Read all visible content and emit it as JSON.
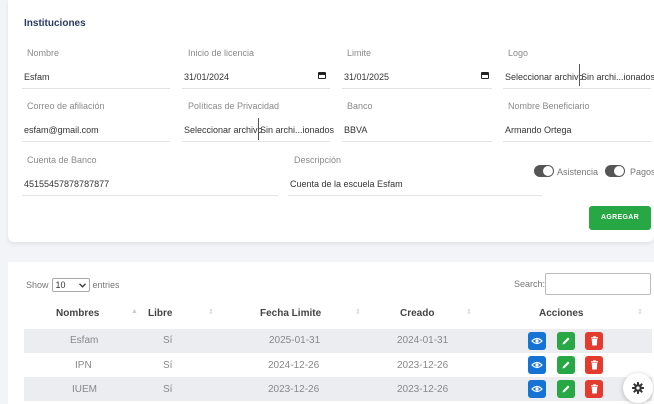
{
  "form": {
    "title": "Instituciones",
    "nombre": {
      "label": "Nombre",
      "value": "Esfam"
    },
    "inicio": {
      "label": "Inicio de licencia",
      "value": "31/01/2024"
    },
    "limite": {
      "label": "Limite",
      "value": "31/01/2025"
    },
    "logo": {
      "label": "Logo",
      "button": "Seleccionar archivo",
      "file": "Sin archi...ionados"
    },
    "correo": {
      "label": "Correo de afiliación",
      "value": "esfam@gmail.com"
    },
    "politicas": {
      "label": "Políticas de Privacidad",
      "button": "Seleccionar archivo",
      "file": "Sin archi...ionados"
    },
    "banco": {
      "label": "Banco",
      "value": "BBVA"
    },
    "beneficiario": {
      "label": "Nombre Beneficiario",
      "value": "Armando Ortega"
    },
    "cuenta": {
      "label": "Cuenta de Banco",
      "value": "45155457878787877"
    },
    "descripcion": {
      "label": "Descripción",
      "value": "Cuenta de la escuela Esfam"
    },
    "toggle_asistencia": "Asistencia",
    "toggle_pagos": "Pagos",
    "submit": "AGREGAR"
  },
  "table": {
    "show_prefix": "Show",
    "show_value": "10",
    "show_suffix": "entries",
    "search_label": "Search:",
    "headers": [
      "Nombres",
      "Libre",
      "Fecha Limite",
      "Creado",
      "Acciones"
    ],
    "rows": [
      {
        "nombre": "Esfam",
        "libre": "Sí",
        "limite": "2025-01-31",
        "creado": "2024-01-31"
      },
      {
        "nombre": "IPN",
        "libre": "Sí",
        "limite": "2024-12-26",
        "creado": "2023-12-26"
      },
      {
        "nombre": "IUEM",
        "libre": "Sí",
        "limite": "2023-12-26",
        "creado": "2023-12-26"
      }
    ]
  },
  "colors": {
    "accent_green": "#28a745",
    "view_blue": "#1673d6",
    "delete_red": "#e33b2e",
    "title_navy": "#2b3a63"
  },
  "icons": [
    "calendar-icon",
    "eye-icon",
    "pencil-icon",
    "trash-icon",
    "gear-icon",
    "chevron-down-icon",
    "sort-icon"
  ]
}
